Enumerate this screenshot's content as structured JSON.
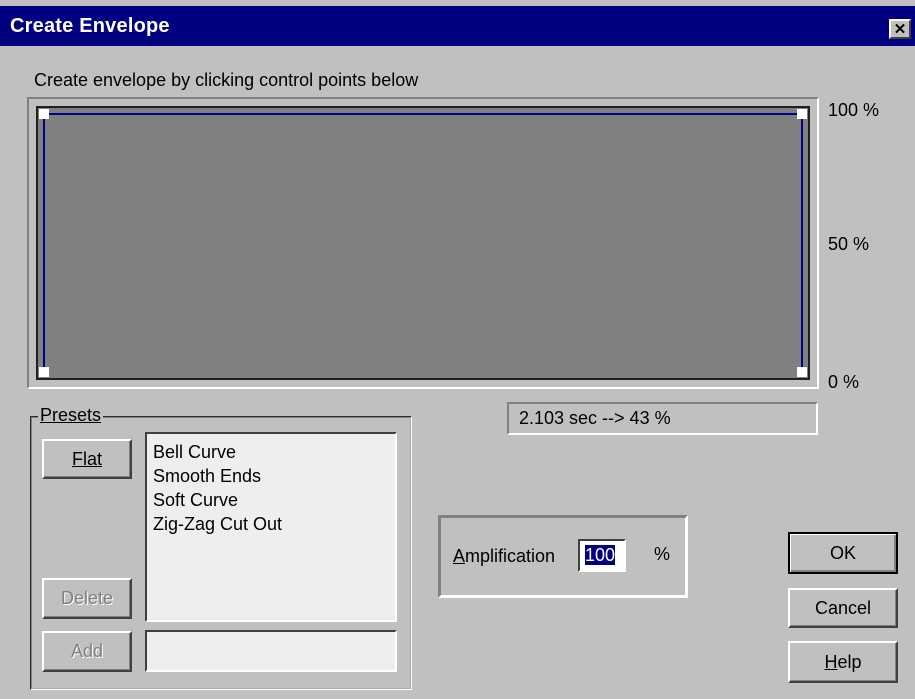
{
  "window": {
    "title": "Create Envelope",
    "close_glyph": "✕"
  },
  "envelope": {
    "instruction": "Create envelope by clicking control points below",
    "y_labels": {
      "top": "100 %",
      "mid": "50 %",
      "bottom": "0 %"
    },
    "control_points_percent": [
      0,
      100,
      100,
      0
    ],
    "line_color": "#00008b",
    "status": "2.103 sec --> 43 %"
  },
  "presets": {
    "group_label": "Presets",
    "flat_label": "Flat",
    "delete_label": "Delete",
    "add_label": "Add",
    "add_value": "",
    "items": [
      "Bell Curve",
      "Smooth Ends",
      "Soft Curve",
      "Zig-Zag Cut Out"
    ]
  },
  "amplification": {
    "label": "Amplification",
    "value": "100",
    "unit": "%"
  },
  "buttons": {
    "ok": "OK",
    "cancel": "Cancel",
    "help": "Help"
  }
}
